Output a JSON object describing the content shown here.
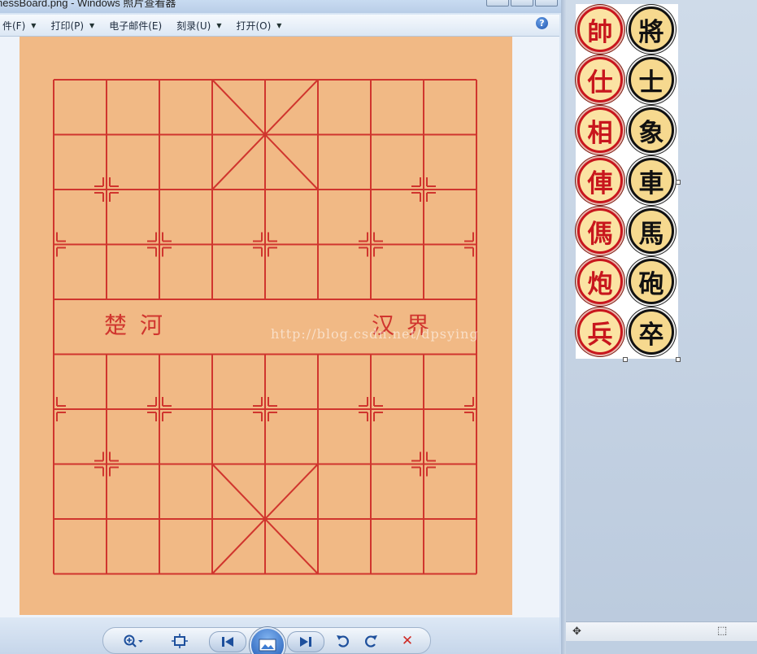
{
  "viewer": {
    "title": "hessBoard.png - Windows 照片查看器",
    "menu": [
      {
        "label": "件(F)",
        "has_caret": true
      },
      {
        "label": "打印(P)",
        "has_caret": true
      },
      {
        "label": "电子邮件(E)",
        "has_caret": false
      },
      {
        "label": "刻录(U)",
        "has_caret": true
      },
      {
        "label": "打开(O)",
        "has_caret": true
      }
    ],
    "help_label": "?",
    "board": {
      "background": "#f1b985",
      "line_color": "#d0352e",
      "river_left": [
        "楚",
        "河"
      ],
      "river_right": [
        "汉",
        "界"
      ]
    },
    "watermark": "http://blog.csdn.net/dpsying",
    "controls": {
      "zoom": "zoom-icon",
      "fit": "actual-size-icon",
      "prev": "previous-icon",
      "slideshow": "slideshow-icon",
      "next": "next-icon",
      "rotate_left": "rotate-ccw-icon",
      "rotate_right": "rotate-cw-icon",
      "delete": "delete-icon"
    }
  },
  "pieces": {
    "red": [
      "帥",
      "仕",
      "相",
      "俥",
      "傌",
      "炮",
      "兵"
    ],
    "black": [
      "將",
      "士",
      "象",
      "車",
      "馬",
      "砲",
      "卒"
    ],
    "red_color": "#c8161d",
    "black_color": "#111111",
    "face_color": "#fbe3a3"
  },
  "paint_status": {
    "move_icon": "move-icon",
    "select_icon": "selection-size-icon"
  }
}
